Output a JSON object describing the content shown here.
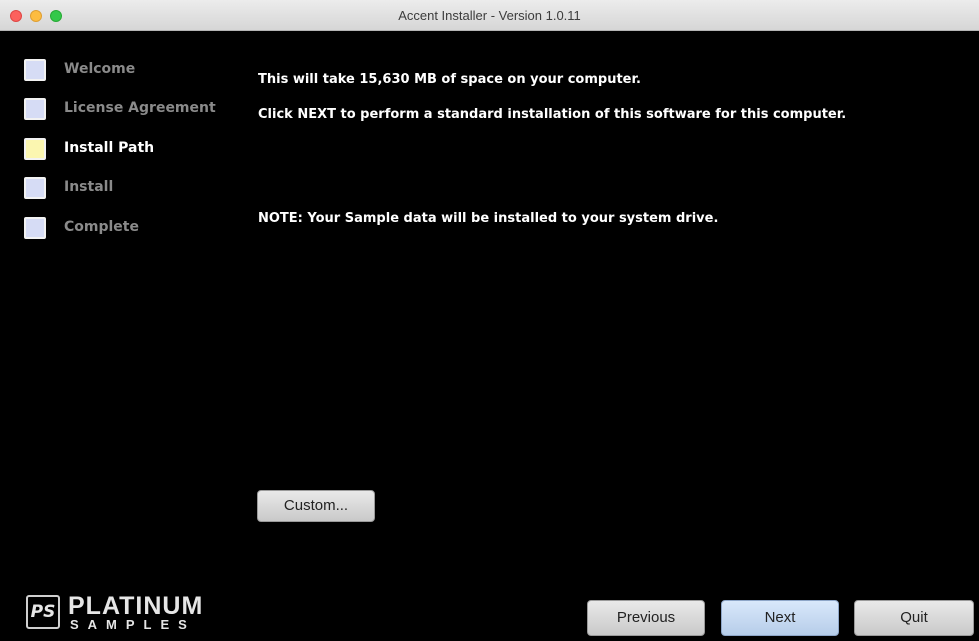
{
  "window": {
    "title": "Accent Installer - Version 1.0.11"
  },
  "steps": [
    {
      "label": "Welcome",
      "state": "inactive"
    },
    {
      "label": "License Agreement",
      "state": "inactive"
    },
    {
      "label": "Install Path",
      "state": "current"
    },
    {
      "label": "Install",
      "state": "inactive"
    },
    {
      "label": "Complete",
      "state": "inactive"
    }
  ],
  "content": {
    "space_message": "This will take 15,630 MB of space on your computer.",
    "next_message": "Click NEXT to perform a standard installation of this software for this computer.",
    "note_message": "NOTE:  Your Sample data will be installed to your system drive."
  },
  "buttons": {
    "custom": "Custom...",
    "previous": "Previous",
    "next": "Next",
    "quit": "Quit"
  },
  "logo": {
    "mark": "PS",
    "name": "PLATINUM",
    "sub": "SAMPLES"
  },
  "colors": {
    "background": "#000000",
    "current_step_box": "#fbf6b0",
    "inactive_step_box": "#d6dcf5",
    "next_button": "#c5d9f1"
  }
}
